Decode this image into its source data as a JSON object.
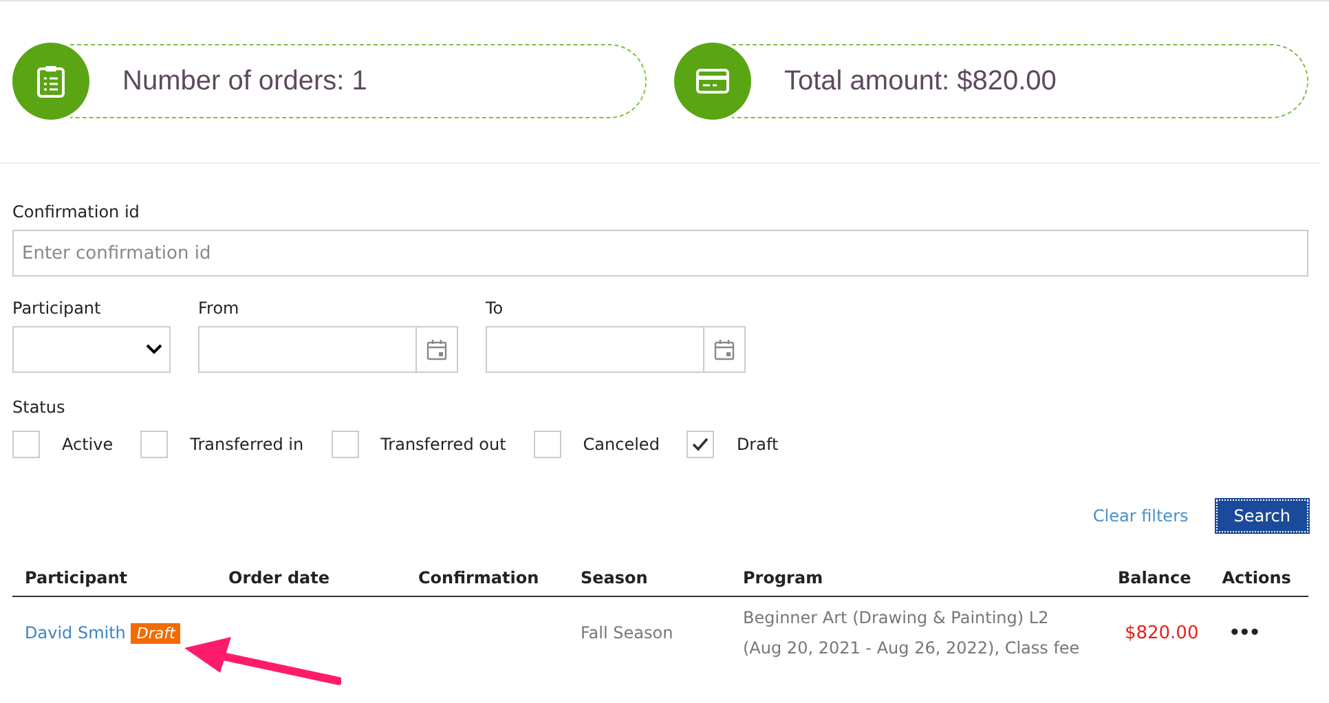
{
  "stats": [
    {
      "kind": "orders",
      "label": "Number of orders: 1"
    },
    {
      "kind": "amount",
      "label": "Total amount: $820.00"
    }
  ],
  "filters": {
    "confirmation": {
      "label": "Confirmation id",
      "placeholder": "Enter confirmation id"
    },
    "participant": {
      "label": "Participant"
    },
    "from": {
      "label": "From"
    },
    "to": {
      "label": "To"
    },
    "status": {
      "label": "Status",
      "options": [
        {
          "label": "Active",
          "checked": false
        },
        {
          "label": "Transferred in",
          "checked": false
        },
        {
          "label": "Transferred out",
          "checked": false
        },
        {
          "label": "Canceled",
          "checked": false
        },
        {
          "label": "Draft",
          "checked": true
        }
      ]
    }
  },
  "buttons": {
    "clear": "Clear filters",
    "search": "Search"
  },
  "table": {
    "columns": [
      "Participant",
      "Order date",
      "Confirmation",
      "Season",
      "Program",
      "Balance",
      "Actions"
    ],
    "rows": [
      {
        "participant": "David Smith",
        "badge": "Draft",
        "order_date": "",
        "confirmation": "",
        "season": "Fall Season",
        "program": [
          "Beginner Art (Drawing & Painting) L2",
          "(Aug 20, 2021 - Aug 26, 2022), Class fee"
        ],
        "balance": "$820.00",
        "actions": "•••"
      }
    ]
  }
}
